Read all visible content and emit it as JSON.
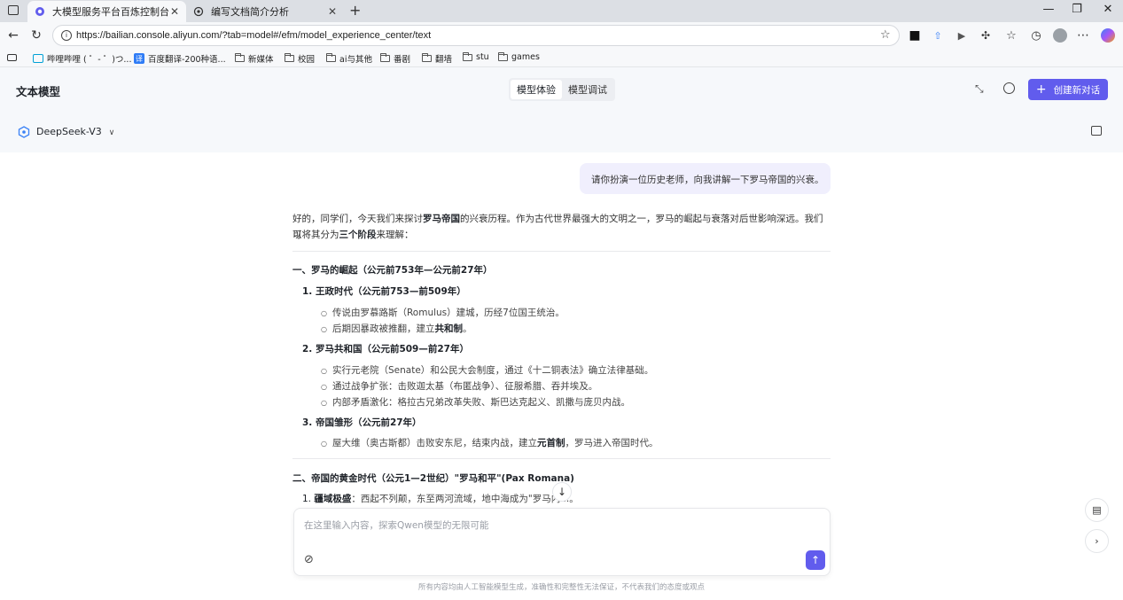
{
  "browser": {
    "tabs": [
      {
        "title": "大模型服务平台百炼控制台",
        "active": true
      },
      {
        "title": "编写文档简介分析",
        "active": false
      }
    ],
    "url": "https://bailian.console.aliyun.com/?tab=model#/efm/model_experience_center/text",
    "bookmarks": [
      "哔哩哔哩 ( ゜- ゜)つ...",
      "百度翻译-200种语...",
      "新媒体",
      "校园",
      "ai与其他",
      "番剧",
      "翻墙",
      "stu",
      "games"
    ]
  },
  "app": {
    "title": "文本模型",
    "modes": [
      "模型体验",
      "模型调试"
    ],
    "new_chat": "创建新对话",
    "model": "DeepSeek-V3",
    "accent": "#615ced"
  },
  "chat": {
    "user_message": "请你扮演一位历史老师，向我讲解一下罗马帝国的兴衰。",
    "intro_1a": "好的，同学们，今天我们来探讨",
    "intro_1b": "罗马帝国",
    "intro_1c": "的兴衰历程。作为古代世界最强大的文明之一，罗马的崛起与衰落对后世影响深远。我们可",
    "intro_2a": "以将其分为",
    "intro_2b": "三个阶段",
    "intro_2c": "来理解：",
    "section1": "一、罗马的崛起（公元前753年—公元前27年）",
    "s1_1": "1. 王政时代（公元前753—前509年）",
    "s1_1_items": [
      "传说由罗慕路斯（Romulus）建城，历经7位国王统治。"
    ],
    "s1_1_b_pre": "后期因暴政被推翻，建立",
    "s1_1_b_bold": "共和制",
    "s1_1_b_post": "。",
    "s1_2": "2. 罗马共和国（公元前509—前27年）",
    "s1_2_items": [
      "实行元老院（Senate）和公民大会制度，通过《十二铜表法》确立法律基础。",
      "通过战争扩张：击败迦太基（布匿战争）、征服希腊、吞并埃及。",
      "内部矛盾激化：格拉古兄弟改革失败、斯巴达克起义、凯撒与庞贝内战。"
    ],
    "s1_3": "3. 帝国雏形（公元前27年）",
    "s1_3_pre": "屋大维（奥古斯都）击败安东尼，结束内战，建立",
    "s1_3_bold": "元首制",
    "s1_3_post": "，罗马进入帝国时代。",
    "section2": "二、帝国的黄金时代（公元1—2世纪）\"罗马和平\"(Pax Romana)",
    "s2_1_bold": "疆域极盛",
    "s2_1_text": "：西起不列颠，东至两河流域，地中海成为\"罗马内...。",
    "input_placeholder": "在这里输入内容，探索Qwen模型的无限可能",
    "disclaimer": "所有内容均由人工智能模型生成，准确性和完整性无法保证，不代表我们的态度或观点"
  }
}
